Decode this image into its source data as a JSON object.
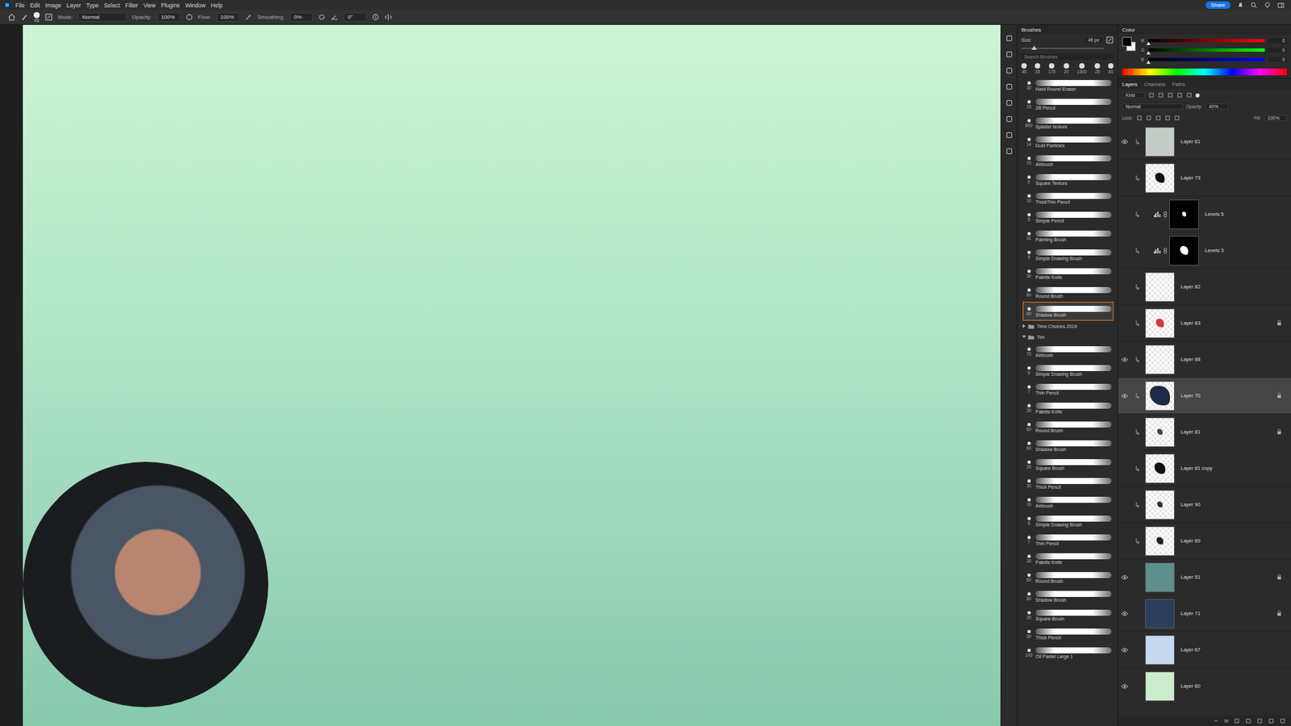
{
  "menu": [
    "File",
    "Edit",
    "Image",
    "Layer",
    "Type",
    "Select",
    "Filter",
    "View",
    "Plugins",
    "Window",
    "Help"
  ],
  "share": "Share",
  "options": {
    "size": "45",
    "mode_label": "Mode:",
    "mode": "Normal",
    "opacity_label": "Opacity:",
    "opacity": "100%",
    "flow_label": "Flow:",
    "flow": "100%",
    "smoothing_label": "Smoothing:",
    "smoothing": "0%",
    "angle": "0°"
  },
  "brushes": {
    "title": "Brushes",
    "size_label": "Size:",
    "size": "45 px",
    "size_level": 0.12,
    "search_placeholder": "Search Brushes",
    "presets": [
      "45",
      "35",
      "175",
      "20",
      "1300",
      "25",
      "40"
    ],
    "items": [
      {
        "kind": "brush",
        "name": "Hard Round Eraser",
        "size": "30",
        "selected": false
      },
      {
        "kind": "brush",
        "name": "2B Pencil",
        "size": "15",
        "selected": false
      },
      {
        "kind": "brush",
        "name": "Splatter texture",
        "size": "800",
        "selected": false
      },
      {
        "kind": "brush",
        "name": "Dust Particles",
        "size": "14",
        "selected": false
      },
      {
        "kind": "brush",
        "name": "Airbrush",
        "size": "70",
        "selected": false
      },
      {
        "kind": "brush",
        "name": "Square Texture",
        "size": "5",
        "selected": false
      },
      {
        "kind": "brush",
        "name": "ThickThin Pencil",
        "size": "10",
        "selected": false
      },
      {
        "kind": "brush",
        "name": "Simple Pencil",
        "size": "5",
        "selected": false
      },
      {
        "kind": "brush",
        "name": "Painting Brush",
        "size": "91",
        "selected": false
      },
      {
        "kind": "brush",
        "name": "Simple Drawing Brush",
        "size": "5",
        "selected": false
      },
      {
        "kind": "brush",
        "name": "Palette Knife",
        "size": "30",
        "selected": false
      },
      {
        "kind": "brush",
        "name": "Round Brush",
        "size": "60",
        "selected": false
      },
      {
        "kind": "brush",
        "name": "Shadow Brush",
        "size": "60",
        "selected": true
      },
      {
        "kind": "folder",
        "name": "Tims Choices 2019",
        "expanded": false
      },
      {
        "kind": "folder",
        "name": "Tim",
        "expanded": true
      },
      {
        "kind": "brush",
        "name": "Airbrush",
        "size": "70",
        "selected": false
      },
      {
        "kind": "brush",
        "name": "Simple Drawing Brush",
        "size": "5",
        "selected": false
      },
      {
        "kind": "brush",
        "name": "Thin Pencil",
        "size": "7",
        "selected": false
      },
      {
        "kind": "brush",
        "name": "Palette Knife",
        "size": "30",
        "selected": false
      },
      {
        "kind": "brush",
        "name": "Round Brush",
        "size": "60",
        "selected": false
      },
      {
        "kind": "brush",
        "name": "Shadow Brush",
        "size": "60",
        "selected": false
      },
      {
        "kind": "brush",
        "name": "Square Brush",
        "size": "20",
        "selected": false
      },
      {
        "kind": "brush",
        "name": "Thick Pencil",
        "size": "30",
        "selected": false
      },
      {
        "kind": "brush",
        "name": "Airbrush",
        "size": "70",
        "selected": false
      },
      {
        "kind": "brush",
        "name": "Simple Drawing Brush",
        "size": "5",
        "selected": false
      },
      {
        "kind": "brush",
        "name": "Thin Pencil",
        "size": "7",
        "selected": false
      },
      {
        "kind": "brush",
        "name": "Palette Knife",
        "size": "30",
        "selected": false
      },
      {
        "kind": "brush",
        "name": "Round Brush",
        "size": "60",
        "selected": false
      },
      {
        "kind": "brush",
        "name": "Shadow Brush",
        "size": "60",
        "selected": false
      },
      {
        "kind": "brush",
        "name": "Square Brush",
        "size": "20",
        "selected": false
      },
      {
        "kind": "brush",
        "name": "Thick Pencil",
        "size": "30",
        "selected": false
      },
      {
        "kind": "brush",
        "name": "Oil Pastel Large 1",
        "size": "143",
        "selected": false
      }
    ]
  },
  "color": {
    "title": "Color",
    "channels": [
      {
        "label": "R",
        "value": "0",
        "level": 0
      },
      {
        "label": "G",
        "value": "0",
        "level": 0
      },
      {
        "label": "B",
        "value": "0",
        "level": 0
      }
    ]
  },
  "layers": {
    "tabs": [
      {
        "label": "Layers",
        "selected": true
      },
      {
        "label": "Channels",
        "selected": false
      },
      {
        "label": "Paths",
        "selected": false
      }
    ],
    "filter": "Kind",
    "blend": "Normal",
    "opacity_label": "Opacity:",
    "opacity": "40%",
    "lock_label": "Lock:",
    "fill_label": "Fill:",
    "fill": "100%",
    "fx": "fx",
    "items": [
      {
        "name": "Layer 61",
        "kind": "layer",
        "visible": true,
        "clipped": true,
        "locked": false,
        "selected": false,
        "color": "#c3ccc6",
        "coverage": 1
      },
      {
        "name": "Layer 73",
        "kind": "layer",
        "visible": false,
        "clipped": true,
        "locked": false,
        "selected": false,
        "color": "#111111",
        "coverage": 0.35
      },
      {
        "name": "Levels 5",
        "kind": "adjustment",
        "visible": false,
        "clipped": true,
        "locked": false,
        "selected": false,
        "color": "#ffffff",
        "coverage": 0.15
      },
      {
        "name": "Levels 3",
        "kind": "adjustment",
        "visible": false,
        "clipped": true,
        "locked": false,
        "selected": false,
        "color": "#ffffff",
        "coverage": 0.3
      },
      {
        "name": "Layer 82",
        "kind": "layer",
        "visible": false,
        "clipped": true,
        "locked": false,
        "selected": false,
        "color": "#cccccc",
        "coverage": 0
      },
      {
        "name": "Layer 83",
        "kind": "layer",
        "visible": false,
        "clipped": true,
        "locked": true,
        "selected": false,
        "color": "#d8383e",
        "coverage": 0.3
      },
      {
        "name": "Layer 88",
        "kind": "layer",
        "visible": true,
        "clipped": true,
        "locked": false,
        "selected": false,
        "color": "#cccccc",
        "coverage": 0
      },
      {
        "name": "Layer 70",
        "kind": "layer",
        "visible": true,
        "clipped": true,
        "locked": true,
        "selected": true,
        "color": "#1c2a44",
        "coverage": 0.7
      },
      {
        "name": "Layer 81",
        "kind": "layer",
        "visible": false,
        "clipped": true,
        "locked": true,
        "selected": false,
        "color": "#444444",
        "coverage": 0.2
      },
      {
        "name": "Layer 81 copy",
        "kind": "layer",
        "visible": false,
        "clipped": true,
        "locked": false,
        "selected": false,
        "color": "#111111",
        "coverage": 0.4
      },
      {
        "name": "Layer 90",
        "kind": "layer",
        "visible": false,
        "clipped": true,
        "locked": false,
        "selected": false,
        "color": "#333333",
        "coverage": 0.2
      },
      {
        "name": "Layer 89",
        "kind": "layer",
        "visible": false,
        "clipped": true,
        "locked": false,
        "selected": false,
        "color": "#222222",
        "coverage": 0.25
      },
      {
        "name": "Layer 51",
        "kind": "layer",
        "visible": true,
        "clipped": false,
        "locked": true,
        "selected": false,
        "color": "#5f8f8c",
        "coverage": 1
      },
      {
        "name": "Layer 71",
        "kind": "layer",
        "visible": true,
        "clipped": false,
        "locked": true,
        "selected": false,
        "color": "#2b3f5c",
        "coverage": 1
      },
      {
        "name": "Layer 67",
        "kind": "layer",
        "visible": true,
        "clipped": false,
        "locked": false,
        "selected": false,
        "color": "#c7d8ef",
        "coverage": 1
      },
      {
        "name": "Layer 60",
        "kind": "layer",
        "visible": true,
        "clipped": false,
        "locked": false,
        "selected": false,
        "color": "#cdeccd",
        "coverage": 1
      }
    ]
  }
}
